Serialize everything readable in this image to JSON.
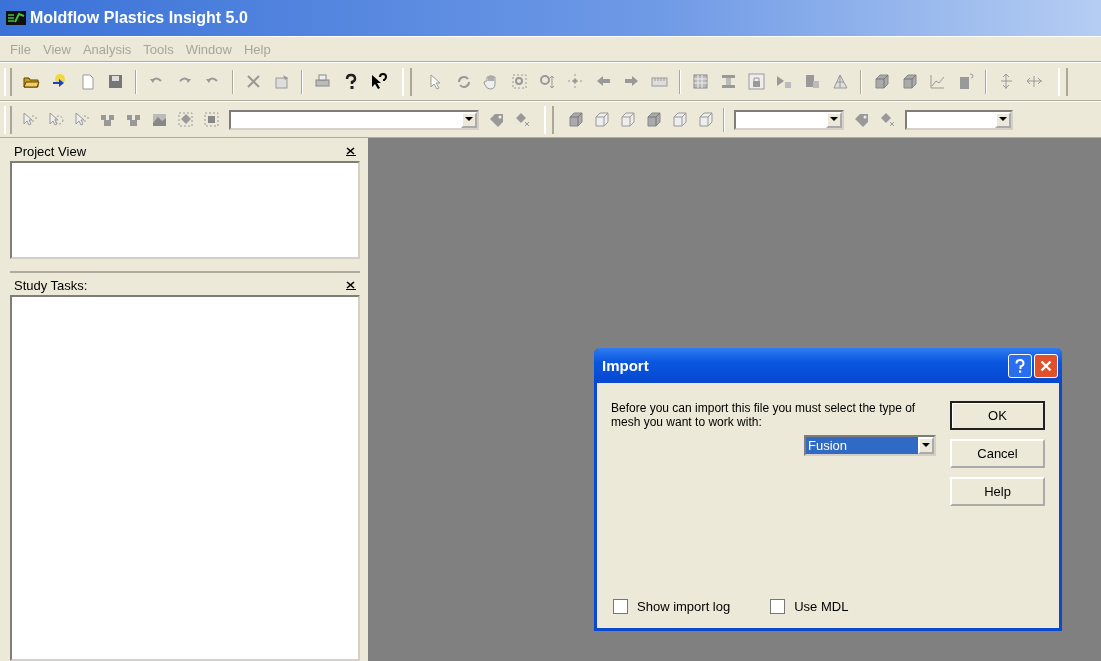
{
  "window": {
    "title": "Moldflow Plastics Insight 5.0"
  },
  "menu": [
    {
      "label": "File",
      "disabled": true
    },
    {
      "label": "View",
      "disabled": true
    },
    {
      "label": "Analysis",
      "disabled": true
    },
    {
      "label": "Tools",
      "disabled": true
    },
    {
      "label": "Window",
      "disabled": true
    },
    {
      "label": "Help",
      "disabled": true
    }
  ],
  "panels": [
    {
      "title": "Project View"
    },
    {
      "title": "Study Tasks:"
    }
  ],
  "dialog": {
    "title": "Import",
    "message": "Before you can import this file you must select the type of mesh you want to work with:",
    "mesh_type": {
      "value": "Fusion"
    },
    "buttons": [
      {
        "label": "OK",
        "default": true
      },
      {
        "label": "Cancel",
        "default": false
      },
      {
        "label": "Help",
        "default": false
      }
    ],
    "checkboxes": [
      {
        "label": "Show import log",
        "checked": false
      },
      {
        "label": "Use MDL",
        "checked": false
      }
    ]
  }
}
